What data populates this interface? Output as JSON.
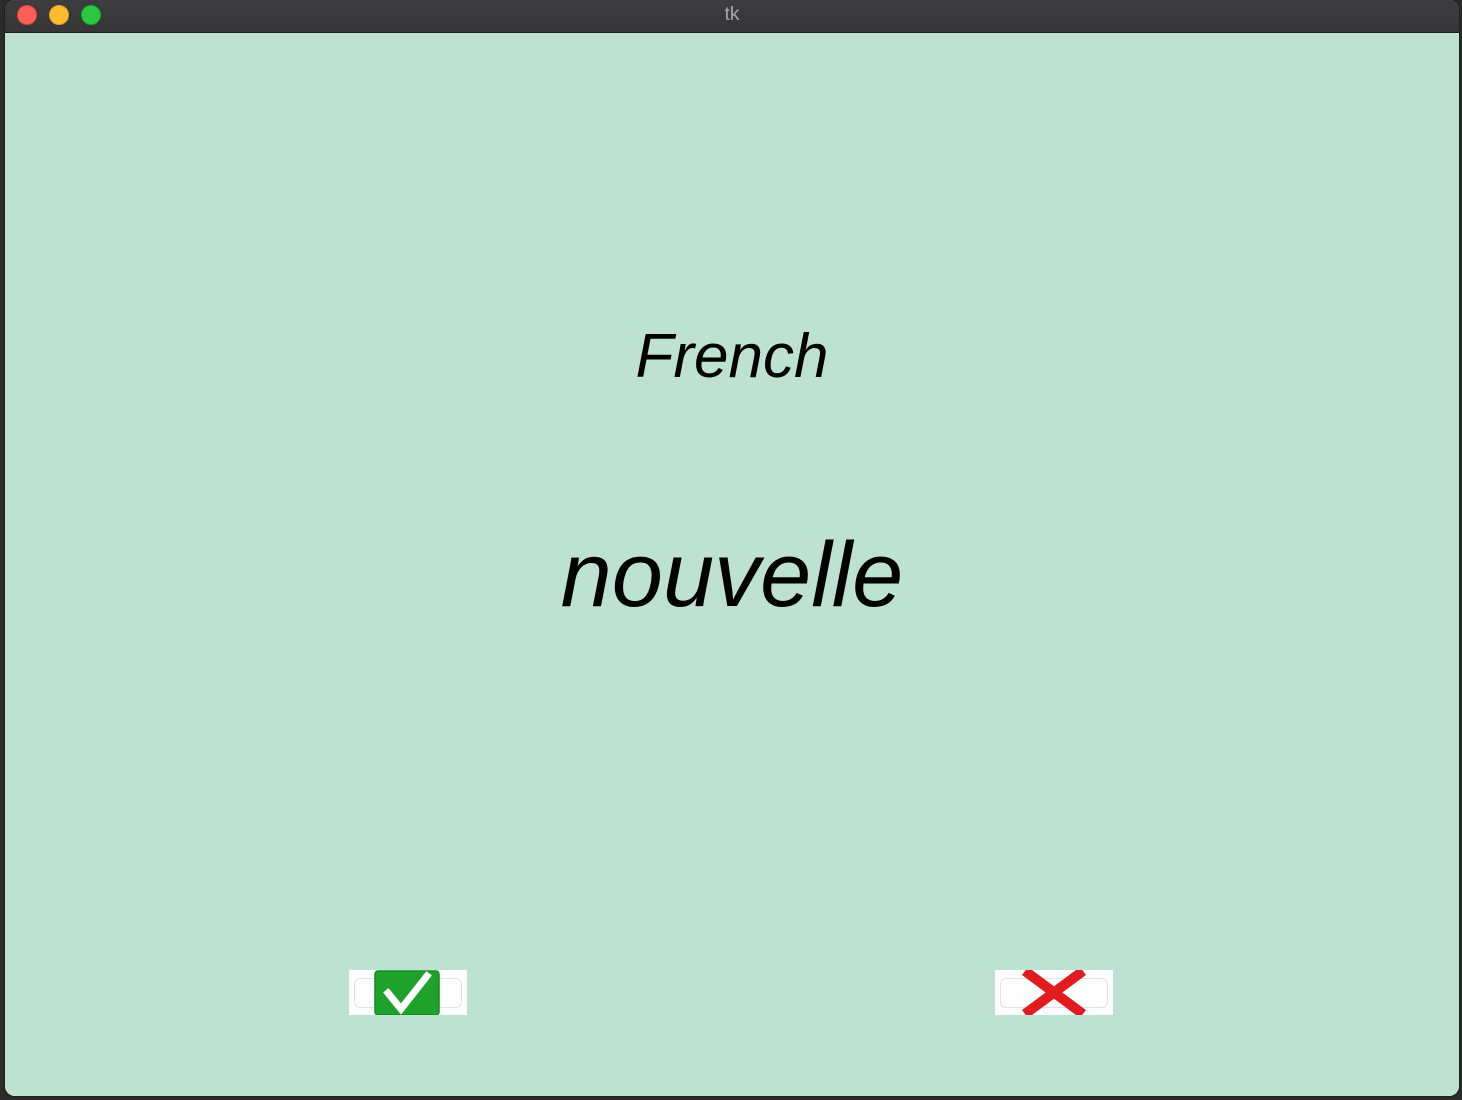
{
  "window": {
    "title": "tk"
  },
  "card": {
    "language": "French",
    "word": "nouvelle"
  },
  "buttons": {
    "right": {
      "icon": "check-mark-icon",
      "color": "#1fa22b"
    },
    "wrong": {
      "icon": "cross-mark-icon",
      "color": "#e01c20"
    }
  },
  "colors": {
    "background": "#bde2d2"
  }
}
